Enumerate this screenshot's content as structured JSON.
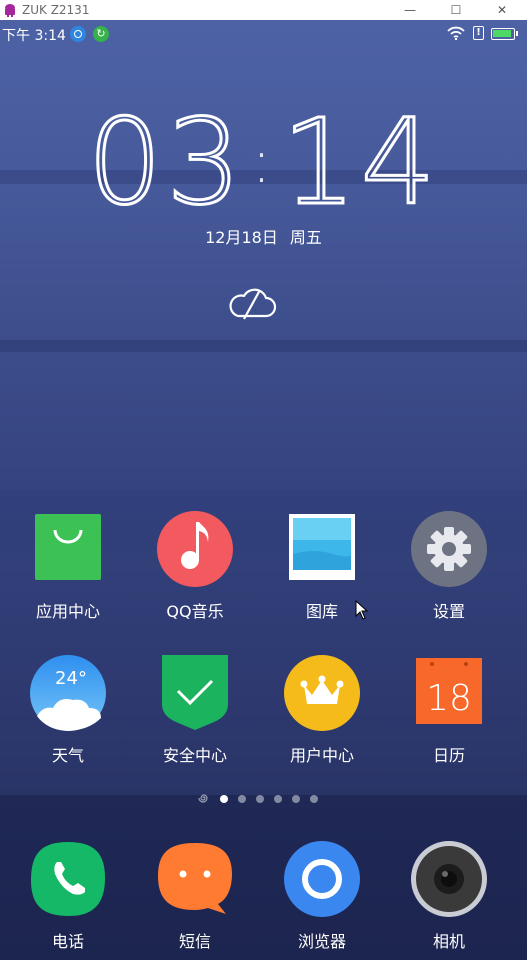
{
  "window": {
    "title": "ZUK Z2131",
    "minimize_glyph": "—",
    "maximize_glyph": "☐",
    "close_glyph": "✕"
  },
  "status_bar": {
    "time": "下午 3:14",
    "notif2_glyph": "↻",
    "sim_glyph": "!",
    "icons": [
      "wifi-icon",
      "sim-alert-icon",
      "battery-icon"
    ]
  },
  "lockscreen": {
    "clock_hours": "03",
    "clock_minutes": "14",
    "date": "12月18日",
    "weekday": "周五",
    "weather_icon": "cloud-offline-icon"
  },
  "apps": [
    {
      "label": "应用中心",
      "icon": "app-store-bag-icon"
    },
    {
      "label": "QQ音乐",
      "icon": "music-note-icon"
    },
    {
      "label": "图库",
      "icon": "gallery-icon"
    },
    {
      "label": "设置",
      "icon": "gear-icon"
    },
    {
      "label": "天气",
      "icon": "weather-icon",
      "badge": "24°"
    },
    {
      "label": "安全中心",
      "icon": "shield-check-icon"
    },
    {
      "label": "用户中心",
      "icon": "crown-icon"
    },
    {
      "label": "日历",
      "icon": "calendar-icon",
      "badge": "18"
    }
  ],
  "dock": [
    {
      "label": "电话",
      "icon": "phone-icon"
    },
    {
      "label": "短信",
      "icon": "message-icon"
    },
    {
      "label": "浏览器",
      "icon": "browser-icon"
    },
    {
      "label": "相机",
      "icon": "camera-icon"
    }
  ],
  "page_indicator": {
    "pages": 6,
    "current": 1
  },
  "colors": {
    "store": "#3cc155",
    "music": "#f25a5f",
    "gallery": "#3db6ea",
    "settings": "#6d7382",
    "shield": "#1cb35f",
    "crown": "#f5bb1b",
    "calendar": "#f7682a",
    "phone": "#14b866",
    "message": "#ff7b32",
    "browser": "#3b87f0",
    "camera": "#3a3a3a"
  }
}
